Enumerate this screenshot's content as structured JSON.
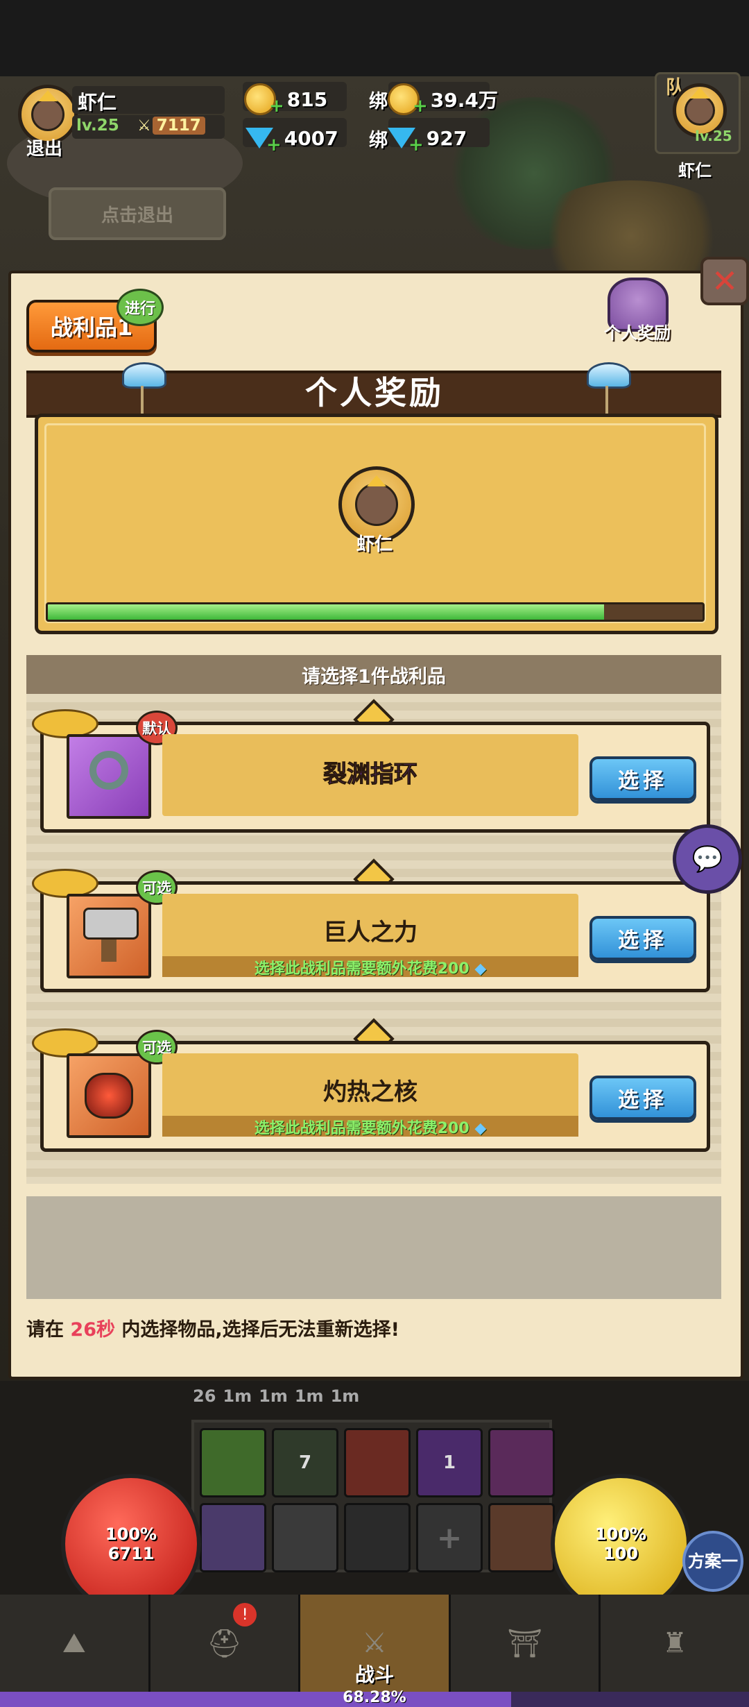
{
  "hud": {
    "player_name": "虾仁",
    "level": "lv.25",
    "power": "7117",
    "exit_label": "退出",
    "gold": "815",
    "gems": "4007",
    "bound_label_gold": "绑",
    "bound_gold": "39.4万",
    "bound_label_gem": "绑",
    "bound_gems": "927",
    "team_label": "队",
    "teammate_level": "lv.25",
    "teammate_name": "虾仁"
  },
  "scene": {
    "exit_button": "点击退出"
  },
  "panel": {
    "tab_label": "战利品1",
    "tab_badge": "进行",
    "chest_label": "个人奖励",
    "banner_title": "个人奖励",
    "player_name": "虾仁",
    "progress": 0.85,
    "choose_header": "请选择1件战利品",
    "items": [
      {
        "name": "裂渊指环",
        "badge": "默认",
        "cost_text": "",
        "select_label": "选择"
      },
      {
        "name": "巨人之力",
        "badge": "可选",
        "cost_text": "选择此战利品需要额外花费200",
        "select_label": "选择"
      },
      {
        "name": "灼热之核",
        "badge": "可选",
        "cost_text": "选择此战利品需要额外花费200",
        "select_label": "选择"
      }
    ],
    "timer_prefix": "请在",
    "timer_seconds": "26秒",
    "timer_suffix": "内选择物品,选择后无法重新选择!"
  },
  "bottom": {
    "buffs": [
      "26",
      "1m",
      "1m",
      "1m",
      "1m"
    ],
    "skill_counts": [
      "",
      "7",
      "",
      "1",
      "",
      "",
      "",
      "",
      "+",
      ""
    ],
    "hp_percent": "100%",
    "hp_value": "6711",
    "mp_percent": "100%",
    "mp_value": "100",
    "plan_button": "方案一",
    "nav_active_label": "战斗",
    "nav_badge": "!",
    "exp_text": "68.28%",
    "exp_fraction": 0.6828
  },
  "colors": {
    "panel_bg": "#f3e6c6",
    "banner": "#4a2e1a",
    "select_button": "#3292d8",
    "cost_text": "#8cf16a",
    "item_name": "#5a2a88"
  }
}
